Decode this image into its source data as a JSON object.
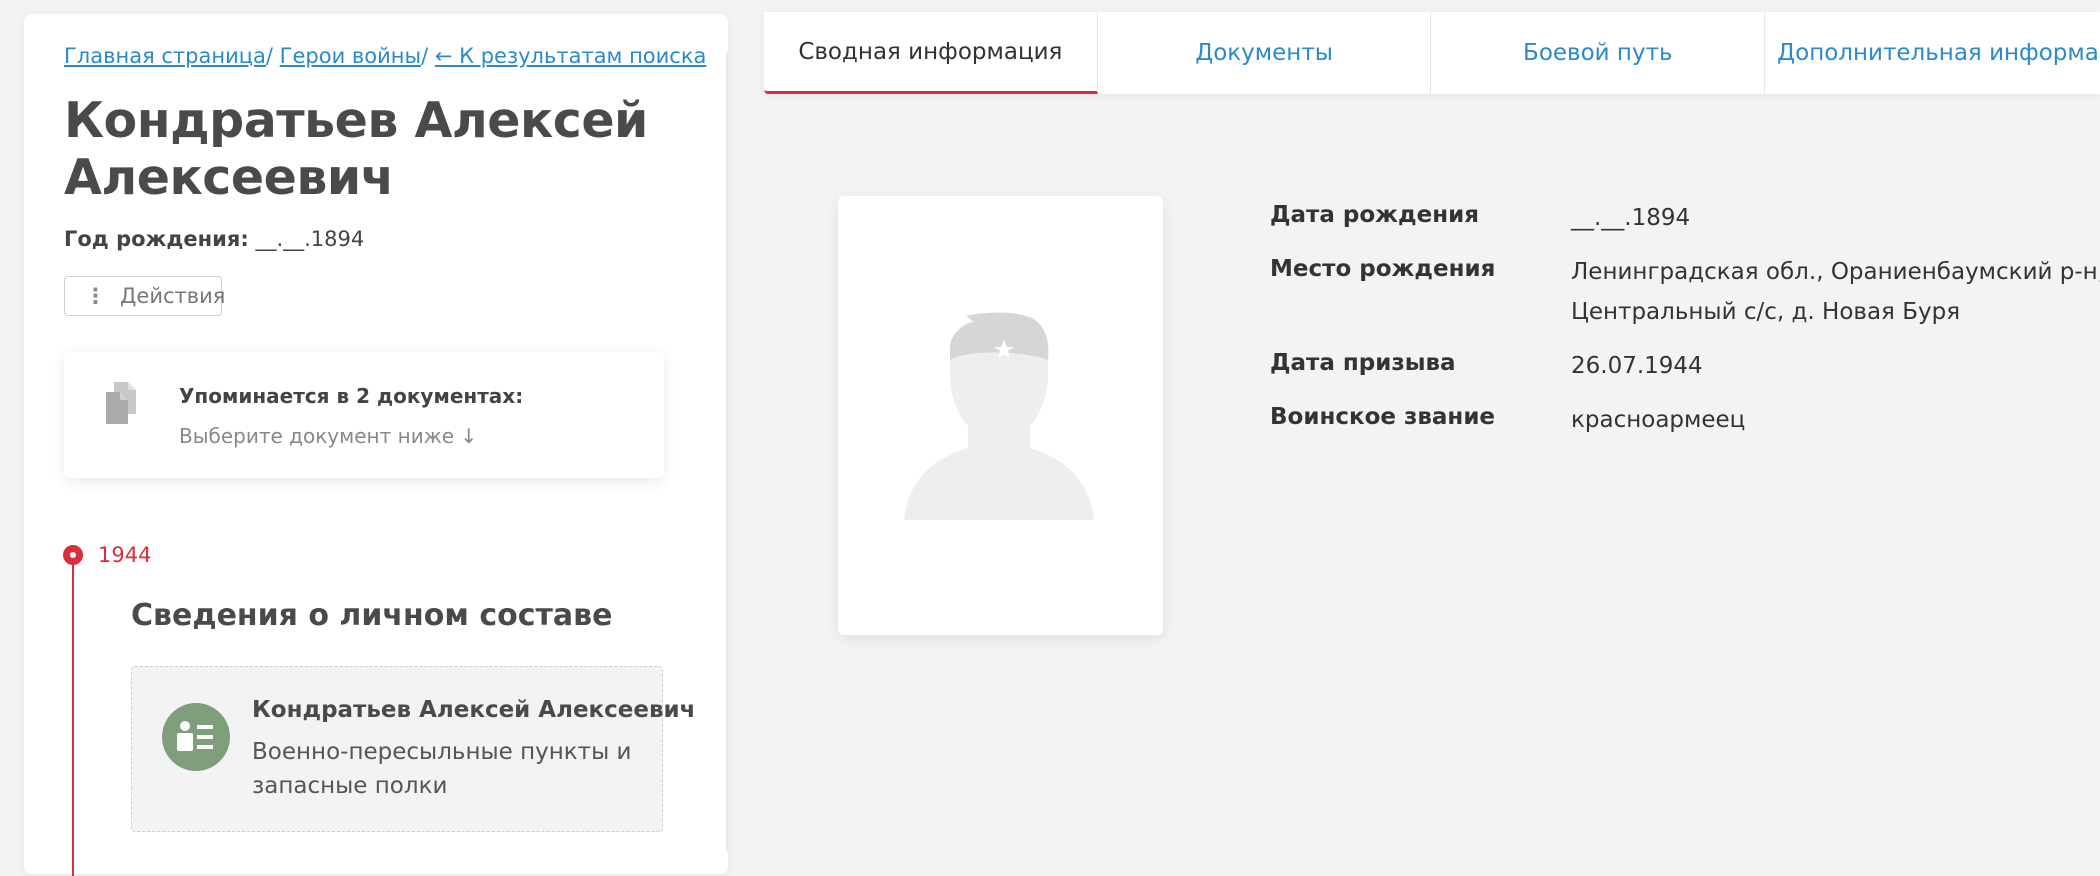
{
  "breadcrumb": {
    "home": "Главная страница",
    "heroes": "Герои войны",
    "back": "← К результатам поиска",
    "sep": "/"
  },
  "person": {
    "name": "Кондратьев Алексей Алексеевич",
    "birth_label": "Год рождения:",
    "birth_value": "__.__.1894"
  },
  "actions": {
    "label": "Действия"
  },
  "mentions": {
    "title": "Упоминается в 2 документах:",
    "subtitle": "Выберите документ ниже ↓"
  },
  "timeline": {
    "year": "1944",
    "section_title": "Сведения о личном составе",
    "doc": {
      "name": "Кондратьев Алексей Алексеевич",
      "desc": "Военно-пересыльные пункты и запасные полки"
    }
  },
  "tabs": [
    {
      "label": "Сводная информация",
      "active": true
    },
    {
      "label": "Документы"
    },
    {
      "label": "Боевой путь"
    },
    {
      "label": "Дополнительная информация"
    }
  ],
  "info": {
    "birth_date_label": "Дата рождения",
    "birth_date_value": "__.__.1894",
    "birth_place_label": "Место рождения",
    "birth_place_line1": "Ленинградская обл., Ораниенбаумский р-н,",
    "birth_place_line2": "Центральный с/с, д. Новая Буря",
    "draft_date_label": "Дата призыва",
    "draft_date_value": "26.07.1944",
    "rank_label": "Воинское звание",
    "rank_value": "красноармеец"
  },
  "colors": {
    "link": "#2a8acb",
    "accent": "#d6303a",
    "doc_icon_bg": "#7f9e7b"
  },
  "icons": [
    "document-icon",
    "person-card-icon",
    "soldier-silhouette-icon",
    "more-dots-icon"
  ]
}
